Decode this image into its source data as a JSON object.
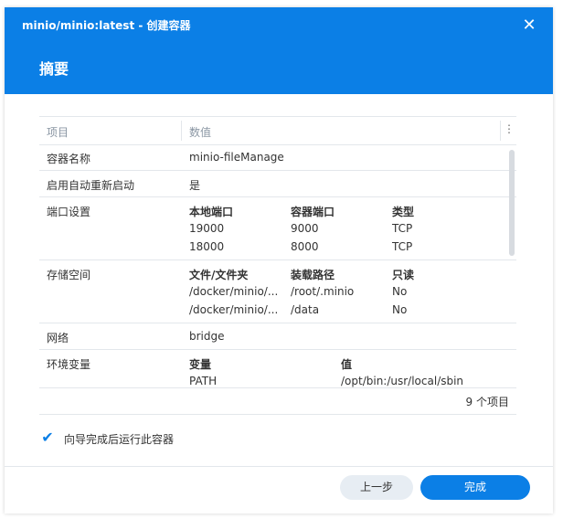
{
  "window": {
    "title": "minio/minio:latest - 创建容器"
  },
  "header": {
    "title": "摘要"
  },
  "grid": {
    "col_key": "项目",
    "col_value": "数值",
    "menu_icon": "⋮",
    "rows": {
      "name": {
        "key": "容器名称",
        "value": "minio-fileManage"
      },
      "autostart": {
        "key": "启用自动重新启动",
        "value": "是"
      },
      "ports": {
        "key": "端口设置",
        "headers": [
          "本地端口",
          "容器端口",
          "类型"
        ],
        "items": [
          [
            "19000",
            "9000",
            "TCP"
          ],
          [
            "18000",
            "8000",
            "TCP"
          ]
        ]
      },
      "storage": {
        "key": "存储空间",
        "headers": [
          "文件/文件夹",
          "装载路径",
          "只读"
        ],
        "items": [
          [
            "/docker/minio/...",
            "/root/.minio",
            "No"
          ],
          [
            "/docker/minio/...",
            "/data",
            "No"
          ]
        ]
      },
      "network": {
        "key": "网络",
        "value": "bridge"
      },
      "env": {
        "key": "环境变量",
        "headers": [
          "变量",
          "值"
        ],
        "items": [
          [
            "PATH",
            "/opt/bin:/usr/local/sbin"
          ]
        ]
      }
    },
    "count": "9 个项目"
  },
  "option": {
    "checked": true,
    "label": "向导完成后运行此容器"
  },
  "buttons": {
    "prev": "上一步",
    "done": "完成"
  },
  "colors": {
    "accent": "#0b7fe6"
  }
}
